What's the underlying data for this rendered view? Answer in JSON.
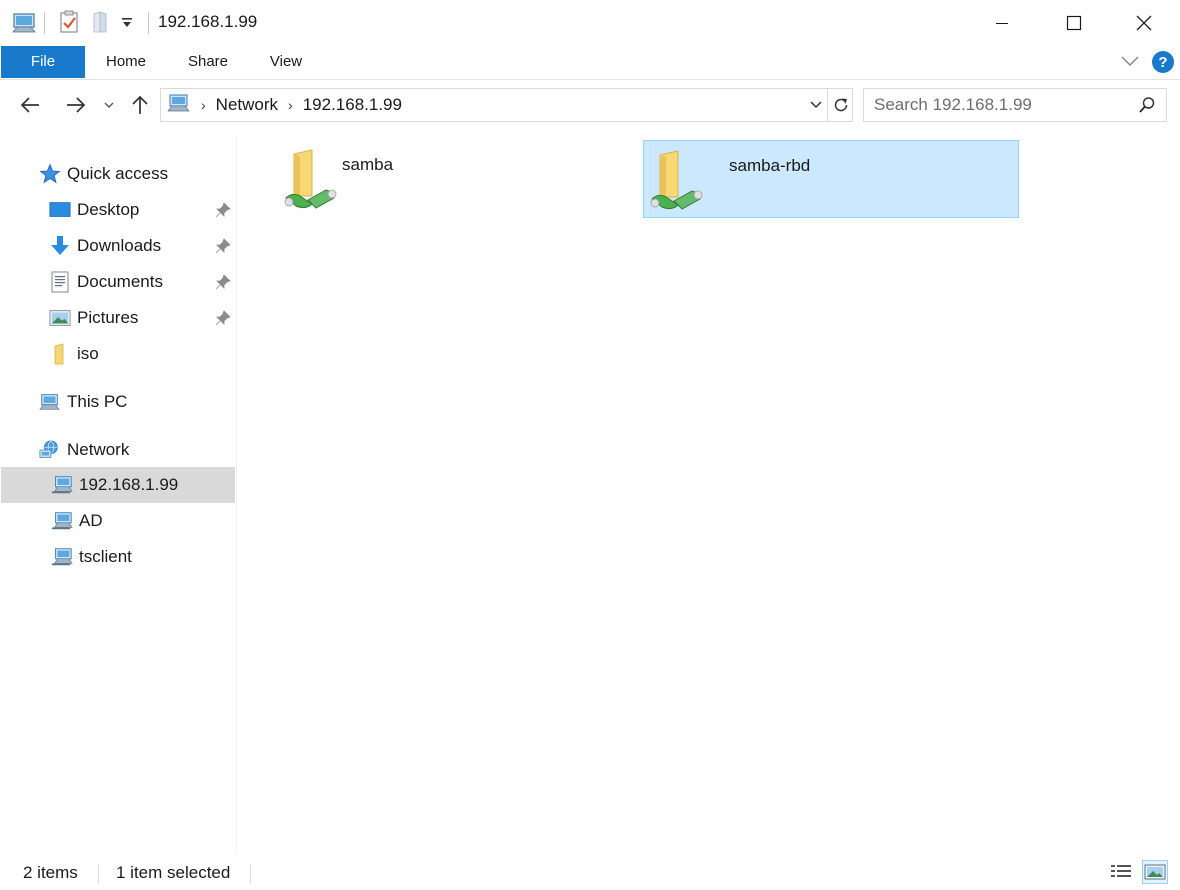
{
  "window": {
    "title": "192.168.1.99",
    "qa_icons": [
      "computer-network-icon",
      "properties-icon",
      "new-folder-icon",
      "customize-qa-dropdown-icon"
    ],
    "controls": [
      "minimize-icon",
      "maximize-icon",
      "close-icon"
    ]
  },
  "ribbon": {
    "tabs": [
      {
        "label": "File",
        "active": true
      },
      {
        "label": "Home"
      },
      {
        "label": "Share"
      },
      {
        "label": "View"
      }
    ],
    "accent_color": "#1979ca"
  },
  "address": {
    "breadcrumbs": [
      "Network",
      "192.168.1.99"
    ]
  },
  "search": {
    "placeholder": "Search 192.168.1.99"
  },
  "navpane": {
    "quick_access": {
      "label": "Quick access"
    },
    "pinned": [
      {
        "label": "Desktop",
        "icon": "desktop-icon"
      },
      {
        "label": "Downloads",
        "icon": "downloads-icon"
      },
      {
        "label": "Documents",
        "icon": "documents-icon"
      },
      {
        "label": "Pictures",
        "icon": "pictures-icon"
      }
    ],
    "folder_iso": {
      "label": "iso"
    },
    "this_pc": {
      "label": "This PC"
    },
    "network": {
      "label": "Network"
    },
    "network_hosts": [
      {
        "label": "192.168.1.99",
        "selected": true
      },
      {
        "label": "AD"
      },
      {
        "label": "tsclient"
      }
    ]
  },
  "content": {
    "items": [
      {
        "name": "samba",
        "selected": false
      },
      {
        "name": "samba-rbd",
        "selected": true
      }
    ],
    "selection_color": "#cce8ff"
  },
  "status": {
    "count": "2 items",
    "selection": "1 item selected"
  }
}
